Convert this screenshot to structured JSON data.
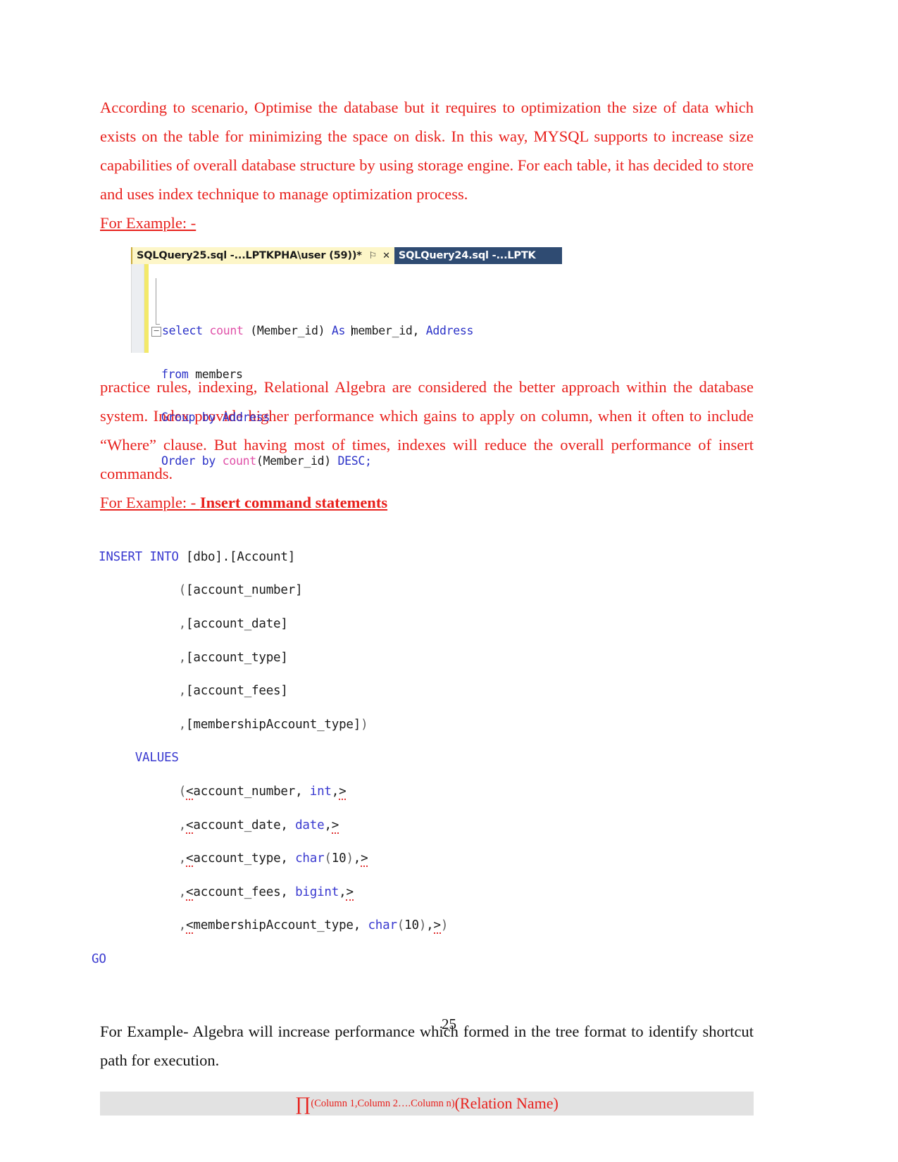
{
  "document": {
    "page_number": "25",
    "colors": {
      "body_red": "#e8201c",
      "body_black": "#111111",
      "tab_active_bg": "#fdf6c8",
      "tab_inactive_bg": "#2f4b72",
      "keyword_blue": "#2b32c8",
      "function_pink": "#e050a8",
      "relation_box_bg": "#e2e2e2",
      "squiggle_red": "#e03030"
    }
  },
  "paragraphs": {
    "p1": "According to scenario, Optimise the database but it requires to optimization the size of data which exists on the table for minimizing the space on disk. In this way, MYSQL supports to increase size capabilities of overall database structure by using storage engine. For each table, it has decided to store and uses index technique to manage optimization process.",
    "p2": "practice rules, indexing, Relational Algebra are considered the better approach within the database system. Index provide higher performance which gains to apply on column, when it often to include “Where” clause. But having most of times, indexes will reduce the overall performance of insert commands.",
    "p3": "For Example- Algebra will increase performance which formed in the tree format to identify shortcut path for execution."
  },
  "labels": {
    "for_example_1": "For Example: -",
    "for_example_2": "For Example: - ",
    "for_example_2_bold": "Insert command statements"
  },
  "ssms": {
    "tab_active": {
      "title": "SQLQuery25.sql -...LPTKPHA\\user (59))*",
      "pin_icon": "pin-icon",
      "close_icon": "close-icon",
      "close_glyph": "✕",
      "pin_glyph": "⚐"
    },
    "tab_inactive": {
      "title": "SQLQuery24.sql -...LPTK"
    },
    "outline_toggle": "−",
    "code_lines": [
      {
        "id": "line1",
        "tokens": [
          {
            "t": "select ",
            "c": "kw"
          },
          {
            "t": "count ",
            "c": "fn"
          },
          {
            "t": "(Member_id) ",
            "c": "plain"
          },
          {
            "t": "As ",
            "c": "kw"
          },
          {
            "t": "member_id, ",
            "c": "plain"
          },
          {
            "t": "Address",
            "c": "kw"
          }
        ]
      },
      {
        "id": "line2",
        "tokens": [
          {
            "t": "from ",
            "c": "kw"
          },
          {
            "t": "members",
            "c": "plain"
          }
        ]
      },
      {
        "id": "line3",
        "tokens": [
          {
            "t": "Group by ",
            "c": "kw"
          },
          {
            "t": "Address",
            "c": "kw"
          }
        ]
      },
      {
        "id": "line4",
        "tokens": [
          {
            "t": "Order by ",
            "c": "kw"
          },
          {
            "t": "count",
            "c": "fn"
          },
          {
            "t": "(Member_id) ",
            "c": "plain"
          },
          {
            "t": "DESC;",
            "c": "kw"
          }
        ]
      }
    ],
    "code_plain_text": "select count (Member_id) As member_id, Address\nfrom members\nGroup by Address\nOrder by count(Member_id) DESC;"
  },
  "insert_statement": {
    "lines": [
      "INSERT INTO [dbo].[Account]",
      "           ([account_number]",
      "           ,[account_date]",
      "           ,[account_type]",
      "           ,[account_fees]",
      "           ,[membershipAccount_type])",
      "     VALUES",
      "           (<account_number, int,>",
      "           ,<account_date, date,>",
      "           ,<account_type, char(10),>",
      "           ,<account_fees, bigint,>",
      "           ,<membershipAccount_type, char(10),>)",
      "GO"
    ],
    "keywords": [
      "INSERT",
      "INTO",
      "VALUES",
      "GO",
      "int",
      "date",
      "char",
      "bigint"
    ]
  },
  "relation_box": {
    "pi_symbol": "∏",
    "subscript": "(Column 1,Column 2….Column n)",
    "relation": "(Relation Name)"
  }
}
